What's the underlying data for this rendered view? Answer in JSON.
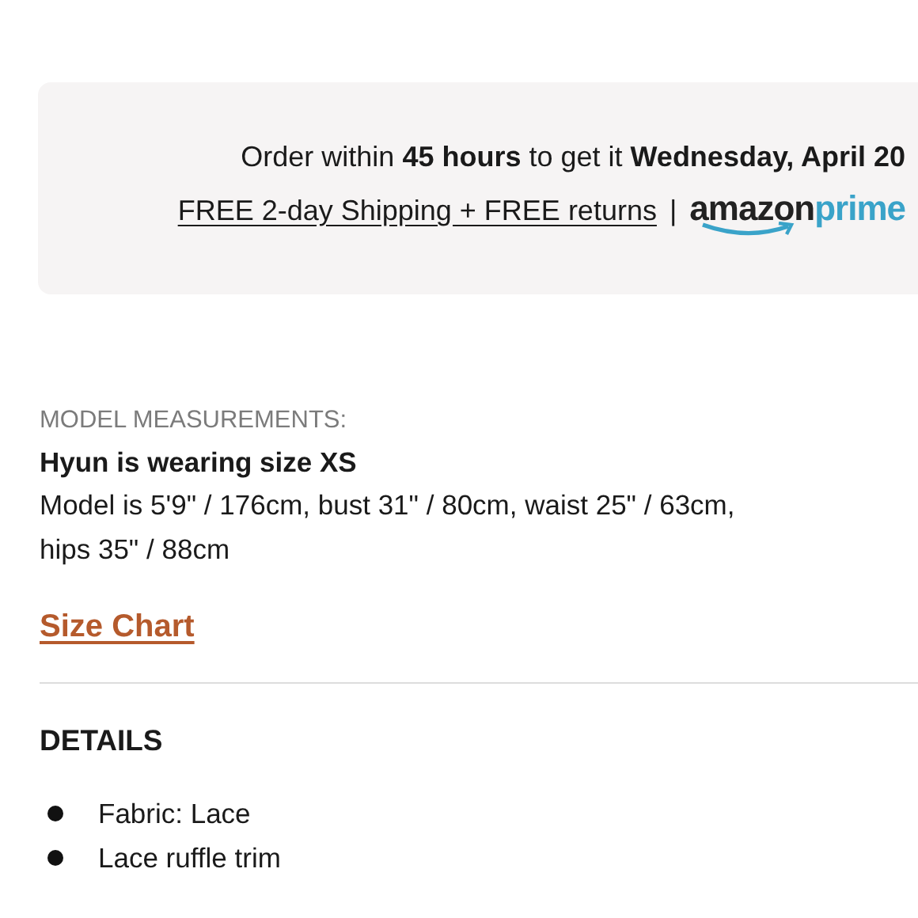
{
  "delivery": {
    "order_line": "Order within **45 hours** to get it **Wednesday, April 20**",
    "shipping_link": "FREE 2-day Shipping + FREE returns",
    "separator": "|",
    "logo_amazon": "amazon",
    "logo_prime": "prime"
  },
  "model": {
    "heading": "MODEL MEASUREMENTS:",
    "wearing": "Hyun is wearing size XS",
    "measurements": "Model is 5'9\" / 176cm, bust 31\" / 80cm, waist 25\" / 63cm, hips 35\" / 88cm",
    "size_chart_link": "Size Chart"
  },
  "details": {
    "heading": "DETAILS",
    "items": [
      "Fabric: Lace",
      "Lace ruffle trim"
    ]
  }
}
